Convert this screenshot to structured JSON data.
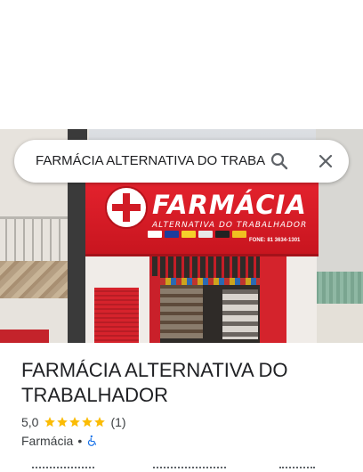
{
  "search": {
    "query": "FARMÁCIA ALTERNATIVA DO TRABA",
    "search_icon": "search-icon",
    "close_icon": "close-icon"
  },
  "photo": {
    "sign_title": "FARMÁCIA",
    "sign_subtitle": "ALTERNATIVA DO TRABALHADOR",
    "sign_phone": "FONE: 81 3634-1301"
  },
  "place": {
    "name": "FARMÁCIA ALTERNATIVA DO TRABALHADOR",
    "rating": "5,0",
    "stars": 5,
    "review_count": "(1)",
    "category": "Farmácia",
    "separator": "•",
    "accessibility_icon": "wheelchair-icon"
  },
  "colors": {
    "star": "#fbbc04",
    "accessible": "#1a73e8",
    "sign_red": "#d11c26"
  }
}
